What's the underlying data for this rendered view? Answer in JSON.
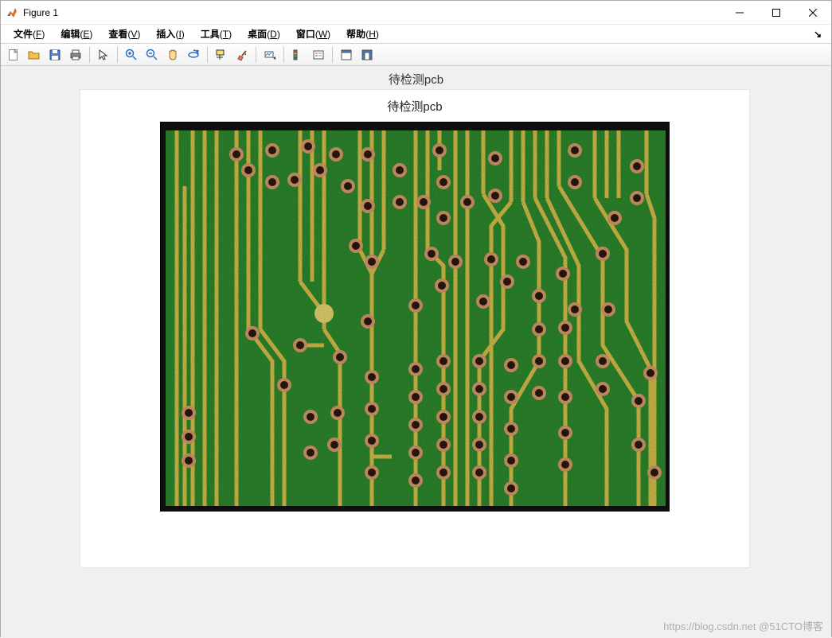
{
  "window": {
    "title": "Figure 1"
  },
  "menu": {
    "file": {
      "label": "文件",
      "accel": "F"
    },
    "edit": {
      "label": "编辑",
      "accel": "E"
    },
    "view": {
      "label": "查看",
      "accel": "V"
    },
    "insert": {
      "label": "插入",
      "accel": "I"
    },
    "tools": {
      "label": "工具",
      "accel": "T"
    },
    "desktop": {
      "label": "桌面",
      "accel": "D"
    },
    "window": {
      "label": "窗口",
      "accel": "W"
    },
    "help": {
      "label": "帮助",
      "accel": "H"
    }
  },
  "toolbar_icons": {
    "new": "new-file-icon",
    "open": "open-file-icon",
    "save": "save-icon",
    "print": "print-icon",
    "pointer": "pointer-icon",
    "zoom_in": "zoom-in-icon",
    "zoom_out": "zoom-out-icon",
    "pan": "pan-hand-icon",
    "rotate": "rotate-3d-icon",
    "datatip": "data-cursor-icon",
    "brush": "brush-icon",
    "link": "link-plots-icon",
    "colorbar": "colorbar-icon",
    "legend": "legend-icon",
    "layout1": "hide-tools-icon",
    "layout2": "show-tools-icon"
  },
  "figure": {
    "suptitle": "待检测pcb",
    "axes_title": "待检测pcb"
  },
  "watermark": "https://blog.csdn.net @51CTO博客"
}
